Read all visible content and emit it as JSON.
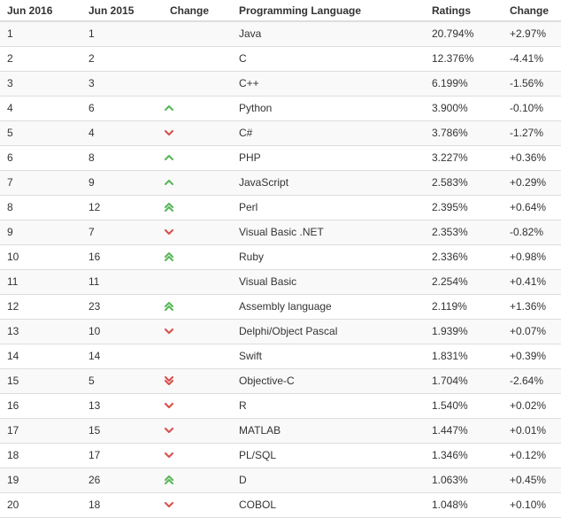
{
  "columns": [
    "Jun 2016",
    "Jun 2015",
    "Change",
    "Programming Language",
    "Ratings",
    "Change"
  ],
  "colors": {
    "up": "#5cb85c",
    "down": "#d9534f",
    "stripe": "#f9f9f9",
    "border": "#dddddd"
  },
  "rows": [
    {
      "jun2016": "1",
      "jun2015": "1",
      "trend": "none",
      "language": "Java",
      "rating": "20.794%",
      "change": "+2.97%"
    },
    {
      "jun2016": "2",
      "jun2015": "2",
      "trend": "none",
      "language": "C",
      "rating": "12.376%",
      "change": "-4.41%"
    },
    {
      "jun2016": "3",
      "jun2015": "3",
      "trend": "none",
      "language": "C++",
      "rating": "6.199%",
      "change": "-1.56%"
    },
    {
      "jun2016": "4",
      "jun2015": "6",
      "trend": "up",
      "language": "Python",
      "rating": "3.900%",
      "change": "-0.10%"
    },
    {
      "jun2016": "5",
      "jun2015": "4",
      "trend": "down",
      "language": "C#",
      "rating": "3.786%",
      "change": "-1.27%"
    },
    {
      "jun2016": "6",
      "jun2015": "8",
      "trend": "up",
      "language": "PHP",
      "rating": "3.227%",
      "change": "+0.36%"
    },
    {
      "jun2016": "7",
      "jun2015": "9",
      "trend": "up",
      "language": "JavaScript",
      "rating": "2.583%",
      "change": "+0.29%"
    },
    {
      "jun2016": "8",
      "jun2015": "12",
      "trend": "double-up",
      "language": "Perl",
      "rating": "2.395%",
      "change": "+0.64%"
    },
    {
      "jun2016": "9",
      "jun2015": "7",
      "trend": "down",
      "language": "Visual Basic .NET",
      "rating": "2.353%",
      "change": "-0.82%"
    },
    {
      "jun2016": "10",
      "jun2015": "16",
      "trend": "double-up",
      "language": "Ruby",
      "rating": "2.336%",
      "change": "+0.98%"
    },
    {
      "jun2016": "11",
      "jun2015": "11",
      "trend": "none",
      "language": "Visual Basic",
      "rating": "2.254%",
      "change": "+0.41%"
    },
    {
      "jun2016": "12",
      "jun2015": "23",
      "trend": "double-up",
      "language": "Assembly language",
      "rating": "2.119%",
      "change": "+1.36%"
    },
    {
      "jun2016": "13",
      "jun2015": "10",
      "trend": "down",
      "language": "Delphi/Object Pascal",
      "rating": "1.939%",
      "change": "+0.07%"
    },
    {
      "jun2016": "14",
      "jun2015": "14",
      "trend": "none",
      "language": "Swift",
      "rating": "1.831%",
      "change": "+0.39%"
    },
    {
      "jun2016": "15",
      "jun2015": "5",
      "trend": "double-down",
      "language": "Objective-C",
      "rating": "1.704%",
      "change": "-2.64%"
    },
    {
      "jun2016": "16",
      "jun2015": "13",
      "trend": "down",
      "language": "R",
      "rating": "1.540%",
      "change": "+0.02%"
    },
    {
      "jun2016": "17",
      "jun2015": "15",
      "trend": "down",
      "language": "MATLAB",
      "rating": "1.447%",
      "change": "+0.01%"
    },
    {
      "jun2016": "18",
      "jun2015": "17",
      "trend": "down",
      "language": "PL/SQL",
      "rating": "1.346%",
      "change": "+0.12%"
    },
    {
      "jun2016": "19",
      "jun2015": "26",
      "trend": "double-up",
      "language": "D",
      "rating": "1.063%",
      "change": "+0.45%"
    },
    {
      "jun2016": "20",
      "jun2015": "18",
      "trend": "down",
      "language": "COBOL",
      "rating": "1.048%",
      "change": "+0.10%"
    }
  ]
}
